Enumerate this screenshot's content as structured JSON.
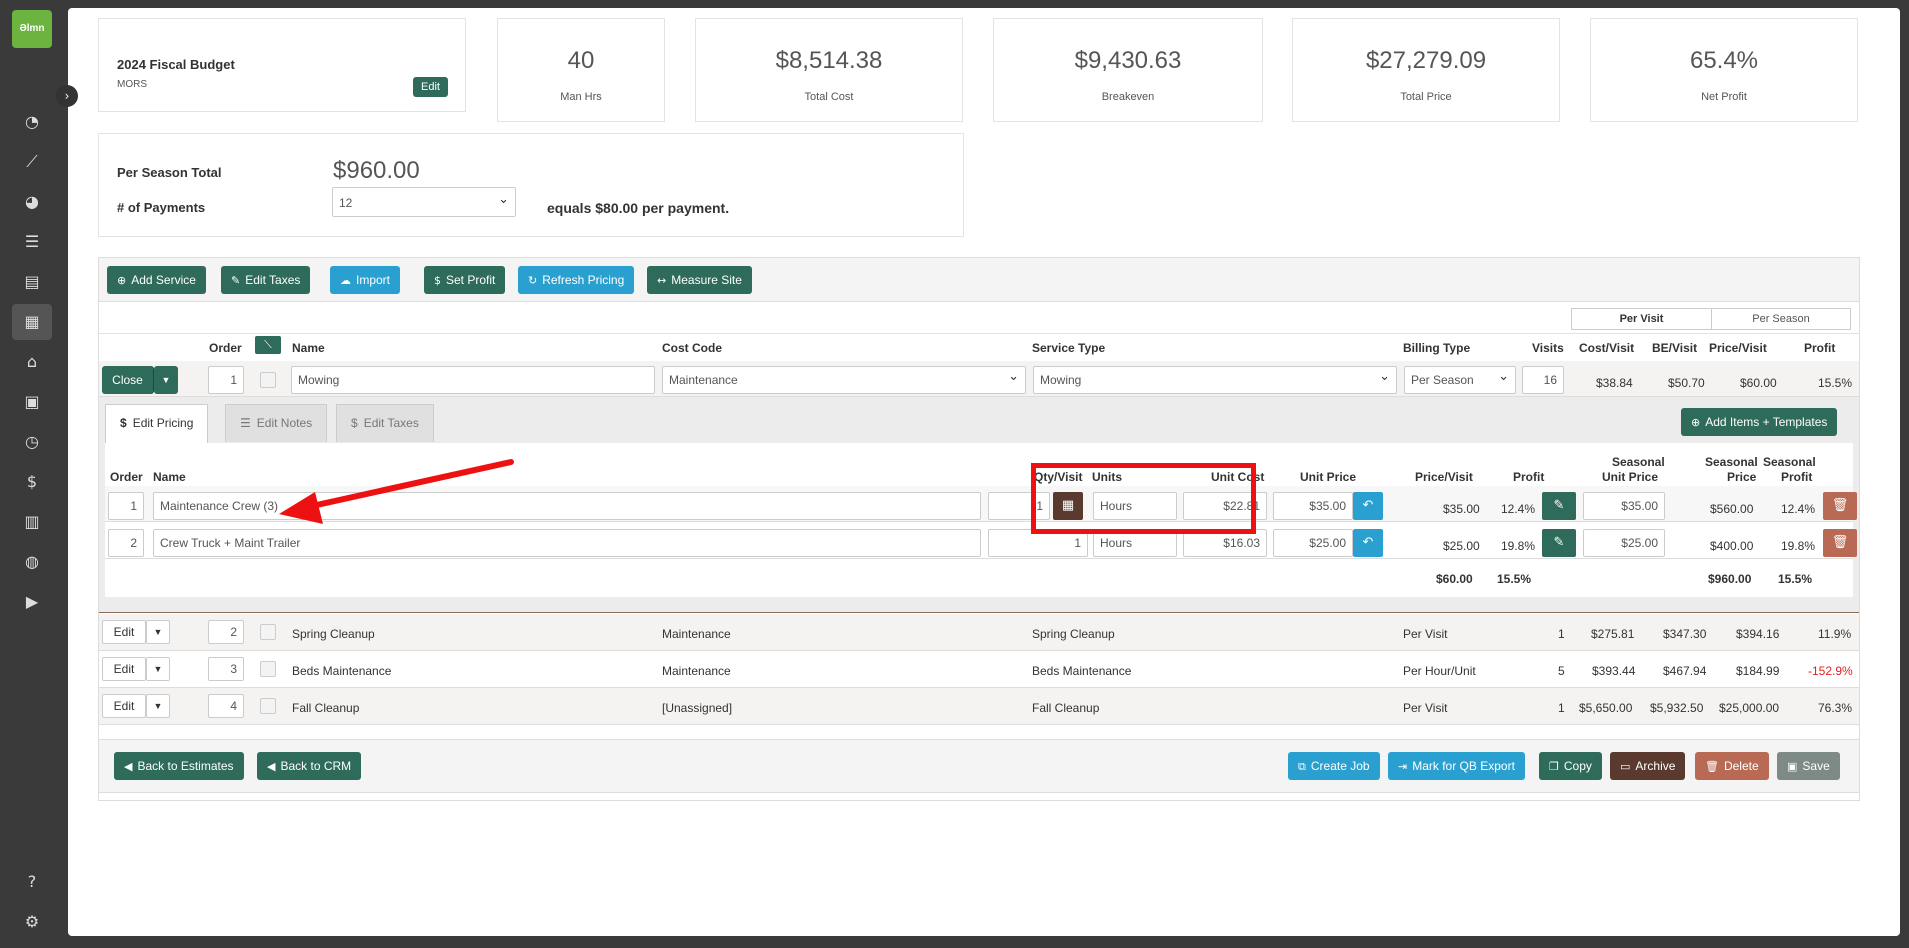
{
  "sidebar": {
    "logo": "Əlmn",
    "icons": [
      "dashboard-icon",
      "chart-line-icon",
      "pie-chart-icon",
      "list-icon",
      "clipboard-icon",
      "calculator-icon",
      "warehouse-icon",
      "calendar-icon",
      "clock-icon",
      "invoice-icon",
      "report-icon",
      "quickbooks-icon",
      "play-circle-icon",
      "help-icon",
      "gear-icon"
    ]
  },
  "budget": {
    "title": "2024 Fiscal Budget",
    "subtitle": "MORS",
    "edit": "Edit"
  },
  "stats": [
    {
      "value": "40",
      "label": "Man Hrs"
    },
    {
      "value": "$8,514.38",
      "label": "Total Cost"
    },
    {
      "value": "$9,430.63",
      "label": "Breakeven"
    },
    {
      "value": "$27,279.09",
      "label": "Total Price"
    },
    {
      "value": "65.4%",
      "label": "Net Profit"
    }
  ],
  "payments": {
    "season_label": "Per Season Total",
    "season_value": "$960.00",
    "num_label": "# of Payments",
    "num_value": "12",
    "equals": "equals $80.00 per payment."
  },
  "toolbar": {
    "add_service": "Add Service",
    "edit_taxes": "Edit Taxes",
    "import": "Import",
    "set_profit": "Set Profit",
    "refresh": "Refresh Pricing",
    "measure": "Measure Site"
  },
  "toggle": {
    "per_visit": "Per Visit",
    "per_season": "Per Season"
  },
  "headers": {
    "order": "Order",
    "name": "Name",
    "cost_code": "Cost Code",
    "service_type": "Service Type",
    "billing_type": "Billing Type",
    "visits": "Visits",
    "cost_visit": "Cost/Visit",
    "be_visit": "BE/Visit",
    "price_visit": "Price/Visit",
    "profit": "Profit"
  },
  "mowing": {
    "action": "Close",
    "order": "1",
    "name": "Mowing",
    "cost_code": "Maintenance",
    "service_type": "Mowing",
    "billing": "Per Season",
    "visits": "16",
    "cost": "$38.84",
    "be": "$50.70",
    "price": "$60.00",
    "profit": "15.5%"
  },
  "tabs": {
    "pricing": "Edit Pricing",
    "notes": "Edit Notes",
    "taxes": "Edit Taxes",
    "add_items": "Add Items + Templates"
  },
  "items_headers": {
    "order": "Order",
    "name": "Name",
    "qty": "Qty/Visit",
    "units": "Units",
    "unit_cost": "Unit Cost",
    "unit_price": "Unit Price",
    "price_visit": "Price/Visit",
    "profit": "Profit",
    "s_unit_price": "Seasonal",
    "s_unit_price2": "Unit Price",
    "s_price": "Seasonal",
    "s_price2": "Price",
    "s_profit": "Seasonal",
    "s_profit2": "Profit"
  },
  "items": [
    {
      "order": "1",
      "name": "Maintenance Crew (3)",
      "qty": "1",
      "units": "Hours",
      "unit_cost": "$22.81",
      "unit_price": "$35.00",
      "price_visit": "$35.00",
      "profit": "12.4%",
      "s_unit_price": "$35.00",
      "s_price": "$560.00",
      "s_profit": "12.4%"
    },
    {
      "order": "2",
      "name": "Crew Truck + Maint Trailer",
      "qty": "1",
      "units": "Hours",
      "unit_cost": "$16.03",
      "unit_price": "$25.00",
      "price_visit": "$25.00",
      "profit": "19.8%",
      "s_unit_price": "$25.00",
      "s_price": "$400.00",
      "s_profit": "19.8%"
    }
  ],
  "items_totals": {
    "price_visit": "$60.00",
    "profit": "15.5%",
    "s_price": "$960.00",
    "s_profit": "15.5%"
  },
  "services": [
    {
      "action": "Edit",
      "order": "2",
      "name": "Spring Cleanup",
      "cost_code": "Maintenance",
      "service_type": "Spring Cleanup",
      "billing": "Per Visit",
      "visits": "1",
      "cost": "$275.81",
      "be": "$347.30",
      "price": "$394.16",
      "profit": "11.9%"
    },
    {
      "action": "Edit",
      "order": "3",
      "name": "Beds Maintenance",
      "cost_code": "Maintenance",
      "service_type": "Beds Maintenance",
      "billing": "Per Hour/Unit",
      "visits": "5",
      "cost": "$393.44",
      "be": "$467.94",
      "price": "$184.99",
      "profit": "-152.9%"
    },
    {
      "action": "Edit",
      "order": "4",
      "name": "Fall Cleanup",
      "cost_code": "[Unassigned]",
      "service_type": "Fall Cleanup",
      "billing": "Per Visit",
      "visits": "1",
      "cost": "$5,650.00",
      "be": "$5,932.50",
      "price": "$25,000.00",
      "profit": "76.3%"
    }
  ],
  "footer": {
    "back_estimates": "Back to Estimates",
    "back_crm": "Back to CRM",
    "create_job": "Create Job",
    "mark_qb": "Mark for QB Export",
    "copy": "Copy",
    "archive": "Archive",
    "delete": "Delete",
    "save": "Save"
  },
  "colors": {
    "primary_green": "#2e6b5a",
    "blue": "#2aa0d0",
    "brown": "#5a3a2e",
    "delete": "#b86a54",
    "annotation_red": "#ee1111",
    "negative": "#e02020"
  }
}
